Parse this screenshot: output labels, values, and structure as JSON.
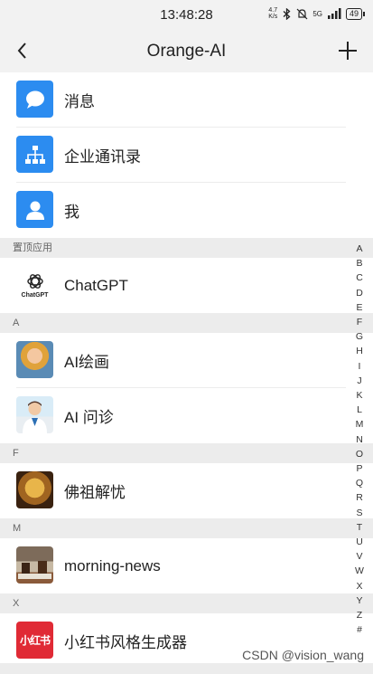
{
  "status_bar": {
    "time": "13:48:28",
    "net_speed_top": "4.7",
    "net_speed_bottom": "K/s",
    "signal": "5G",
    "battery": "49"
  },
  "nav": {
    "title": "Orange-AI"
  },
  "menu": [
    {
      "label": "消息",
      "icon": "chat-bubble-icon"
    },
    {
      "label": "企业通讯录",
      "icon": "org-chart-icon"
    },
    {
      "label": "我",
      "icon": "person-icon"
    }
  ],
  "sections": [
    {
      "header": "置顶应用",
      "items": [
        {
          "name": "ChatGPT",
          "icon": "openai-logo-icon",
          "logo_text": "ChatGPT"
        }
      ]
    },
    {
      "header": "A",
      "items": [
        {
          "name": "AI绘画",
          "icon": "ai-painting-avatar"
        },
        {
          "name": "AI 问诊",
          "icon": "doctor-avatar"
        }
      ]
    },
    {
      "header": "F",
      "items": [
        {
          "name": "佛祖解忧",
          "icon": "buddha-avatar"
        }
      ]
    },
    {
      "header": "M",
      "items": [
        {
          "name": "morning-news",
          "icon": "coffee-news-avatar"
        }
      ]
    },
    {
      "header": "X",
      "items": [
        {
          "name": "小红书风格生成器",
          "icon": "xiaohongshu-logo",
          "logo_text": "小红书"
        }
      ]
    }
  ],
  "alpha_index": [
    "A",
    "B",
    "C",
    "D",
    "E",
    "F",
    "G",
    "H",
    "I",
    "J",
    "K",
    "L",
    "M",
    "N",
    "O",
    "P",
    "Q",
    "R",
    "S",
    "T",
    "U",
    "V",
    "W",
    "X",
    "Y",
    "Z",
    "#"
  ],
  "watermark": "CSDN @vision_wang",
  "colors": {
    "accent_blue": "#2c8cf0",
    "xhs_red": "#e02a35",
    "nav_bg": "#f2f2f2",
    "section_bg": "#ececec"
  }
}
